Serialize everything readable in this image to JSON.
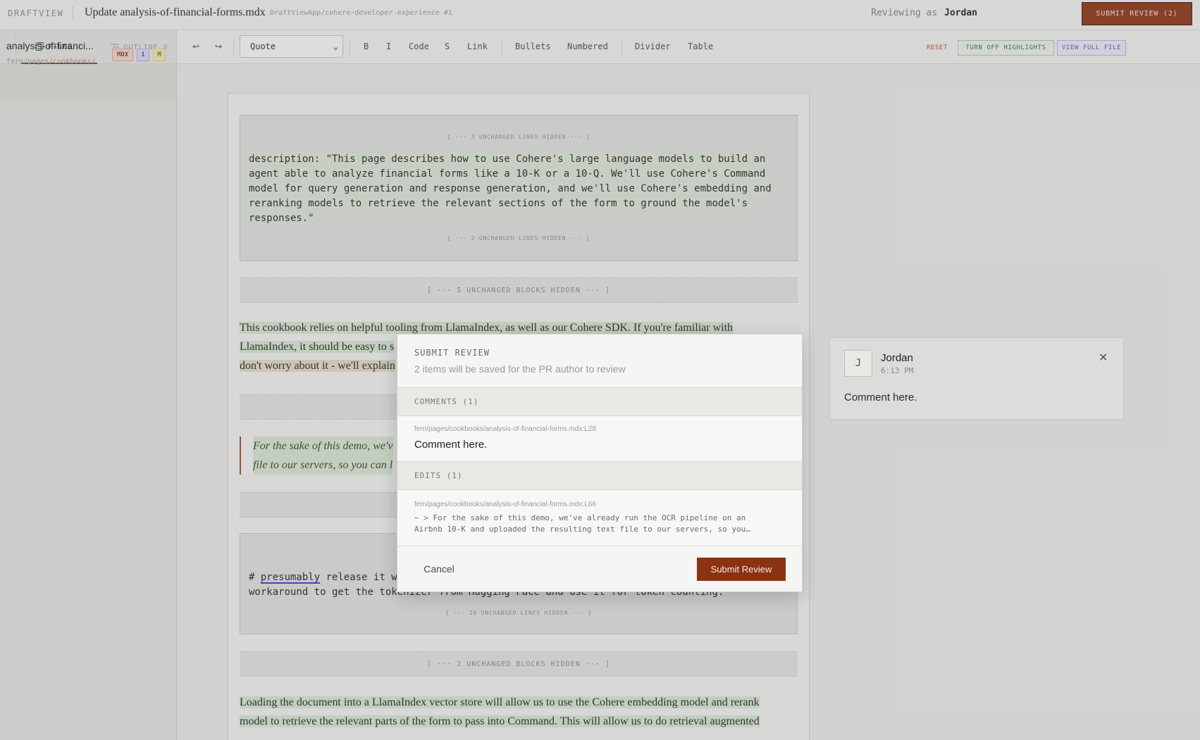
{
  "topbar": {
    "brand": "DRAFTVIEW",
    "title": "Update analysis-of-financial-forms.mdx",
    "repo": "DraftViewApp/cohere-developer-experience #1",
    "reviewing_prefix": "Reviewing as",
    "reviewer": "Jordan",
    "submit_label": "SUBMIT REVIEW (2)"
  },
  "sidebar": {
    "collapse_icon": "chevron-left-icon",
    "tabs": [
      {
        "label": "FILES",
        "count": "1",
        "icon": "files-icon",
        "active": true
      },
      {
        "label": "OUTLINE",
        "count": "0",
        "icon": "outline-icon",
        "active": false
      }
    ],
    "file": {
      "name": "analysis-of-financi...",
      "path": "fern/pages/cookbooks/",
      "badges": [
        "MDX",
        "1",
        "M"
      ]
    }
  },
  "toolbar": {
    "undo": "↩",
    "redo": "↪",
    "block_type": "Quote",
    "buttons": [
      "B",
      "I",
      "Code",
      "S",
      "Link",
      "Bullets",
      "Numbered",
      "Divider",
      "Table"
    ],
    "reset": "RESET",
    "highlights": "TURN OFF HIGHLIGHTS",
    "view_full": "VIEW FULL FILE"
  },
  "content": {
    "block1_hidden_top": "[ ··· 3 UNCHANGED LINES HIDDEN ··· ]",
    "block1_lines": [
      "description: \"This page describes how to use Cohere's large language models to build an",
      "agent able to analyze financial forms like a 10-K or a 10-Q. We'll use Cohere's Command",
      "model for query generation and response generation, and we'll use Cohere's embedding and",
      "reranking models to retrieve the relevant sections of the form to ground the model's",
      "responses.\""
    ],
    "block1_hidden_bottom": "[ ··· 2 UNCHANGED LINES HIDDEN ··· ]",
    "hidden_blocks_1": "[ ··· 5 UNCHANGED BLOCKS HIDDEN ··· ]",
    "para1_line1": "This cookbook relies on helpful tooling from LlamaIndex, as well as our Cohere SDK. If you're familiar with",
    "para1_line2": "LlamaIndex, it should be easy to s",
    "para1_line3": "don't worry about it - we'll explain",
    "quote_line1": "For the sake of this demo, we'v",
    "quote_line2": "file to our servers, so you can l",
    "block2_line1_word": "presumably",
    "block2_line1_pre": "# ",
    "block2_line1_post": " release it w",
    "block2_line2": "workaround to get the tokenizer from Hugging Face and use it for token counting.",
    "block2_hidden": "[ ··· 10 UNCHANGED LINES HIDDEN ··· ]",
    "hidden_blocks_2": "[ ··· 2 UNCHANGED BLOCKS HIDDEN ··· ]",
    "para2_line1": "Loading the document into a LlamaIndex vector store will allow us to use the Cohere embedding model and rerank",
    "para2_line2": "model to retrieve the relevant parts of the form to pass into Command. This will allow us to do retrieval augmented"
  },
  "modal": {
    "title": "SUBMIT REVIEW",
    "subtitle": "2 items will be saved for the PR author to review",
    "comments_header": "COMMENTS (1)",
    "comment_path": "fern/pages/cookbooks/analysis-of-financial-forms.mdx:L28",
    "comment_text": "Comment here.",
    "edits_header": "EDITS (1)",
    "edit_path": "fern/pages/cookbooks/analysis-of-financial-forms.mdx:L66",
    "edit_line1": "~ > For the sake of this demo, we've already run the OCR pipeline on an",
    "edit_line2": "Airbnb 10-K and uploaded the resulting text file to our servers, so you…",
    "cancel": "Cancel",
    "submit": "Submit Review"
  },
  "comment_card": {
    "avatar_initial": "J",
    "user": "Jordan",
    "time": "6:13 PM",
    "close_icon": "close-icon",
    "body": "Comment here."
  }
}
